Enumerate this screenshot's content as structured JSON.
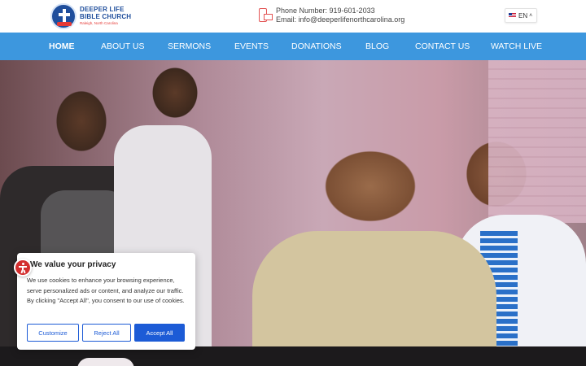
{
  "header": {
    "logo": {
      "line1": "DEEPER LIFE",
      "line2": "BIBLE CHURCH",
      "line3": "Raleigh, North Carolina"
    },
    "contact": {
      "phone": "Phone Number: 919-601-2033",
      "email": "Email: info@deeperlifenorthcarolina.org",
      "icon": "phone-email-icon"
    },
    "language": {
      "code": "EN",
      "flag": "us-flag-icon",
      "caret": "^"
    }
  },
  "nav": {
    "items": [
      {
        "label": "HOME",
        "active": true
      },
      {
        "label": "ABOUT US"
      },
      {
        "label": "SERMONS"
      },
      {
        "label": "EVENTS"
      },
      {
        "label": "DONATIONS"
      },
      {
        "label": "BLOG"
      },
      {
        "label": "CONTACT US"
      },
      {
        "label": "WATCH LIVE"
      }
    ],
    "background_color": "#3d97de"
  },
  "hero": {
    "image": "congregation-photo"
  },
  "accessibility": {
    "icon": "accessibility-icon",
    "color": "#d32f2f"
  },
  "cookie": {
    "title": "We value your privacy",
    "body": "We use cookies to enhance your browsing experience, serve personalized ads or content, and analyze our traffic. By clicking \"Accept All\", you consent to our use of cookies.",
    "buttons": {
      "customize": "Customize",
      "reject": "Reject All",
      "accept": "Accept All"
    },
    "accent_color": "#1c5bd6"
  }
}
